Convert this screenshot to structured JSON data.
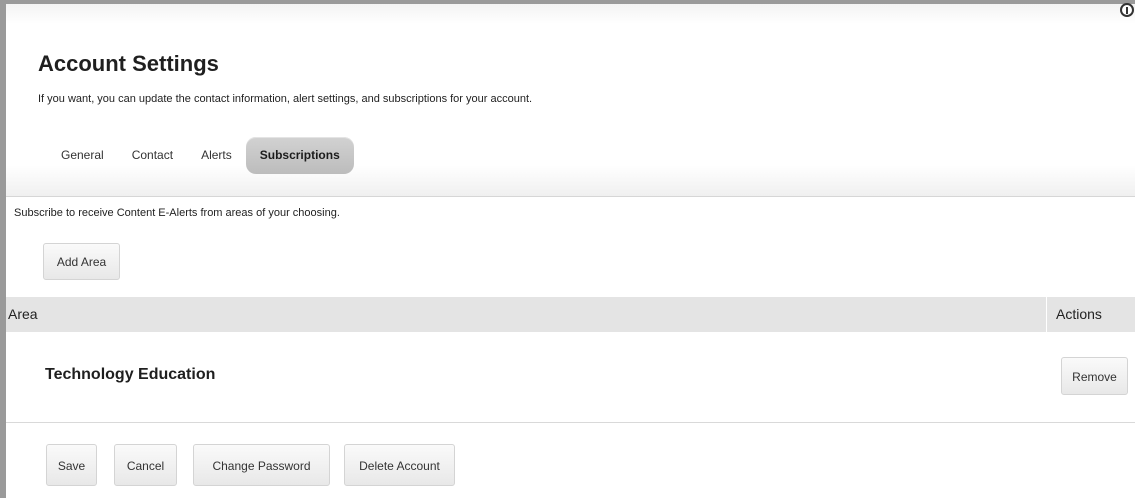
{
  "page": {
    "title": "Account Settings",
    "subtitle": "If you want, you can update the contact information, alert settings, and subscriptions for your account."
  },
  "tabs": [
    {
      "label": "General",
      "active": false
    },
    {
      "label": "Contact",
      "active": false
    },
    {
      "label": "Alerts",
      "active": false
    },
    {
      "label": "Subscriptions",
      "active": true
    }
  ],
  "subscriptions": {
    "intro": "Subscribe to receive Content E-Alerts from areas of your choosing.",
    "add_label": "Add Area",
    "columns": {
      "area": "Area",
      "actions": "Actions"
    },
    "rows": [
      {
        "area": "Technology Education",
        "action_label": "Remove"
      }
    ]
  },
  "footer": {
    "save_label": "Save",
    "cancel_label": "Cancel",
    "change_password_label": "Change Password",
    "delete_account_label": "Delete Account"
  },
  "icons": {
    "corner": "help-icon"
  },
  "colors": {
    "active_tab": "#c6c6c6",
    "table_header": "#e4e4e4",
    "frame": "#9a9a9a"
  }
}
